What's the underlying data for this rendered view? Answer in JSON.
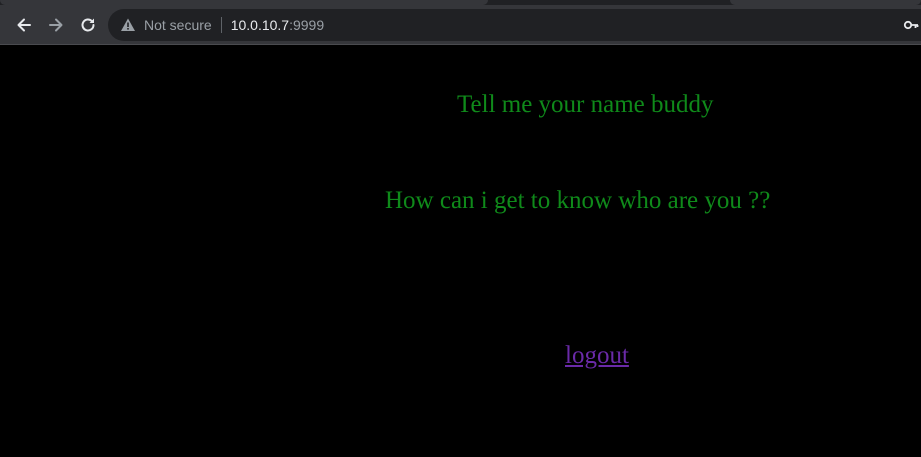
{
  "browser": {
    "security_label": "Not secure",
    "url_host": "10.0.10.7",
    "url_port": ":9999",
    "icons": [
      "back-arrow-icon",
      "forward-arrow-icon",
      "reload-icon",
      "warning-icon",
      "key-icon"
    ]
  },
  "page": {
    "heading": "Tell me your name buddy",
    "question": "How can i get to know who are you ??",
    "logout_label": "logout",
    "colors": {
      "text": "#0f8a1a",
      "link": "#6a2aa8",
      "background": "#000000"
    }
  }
}
